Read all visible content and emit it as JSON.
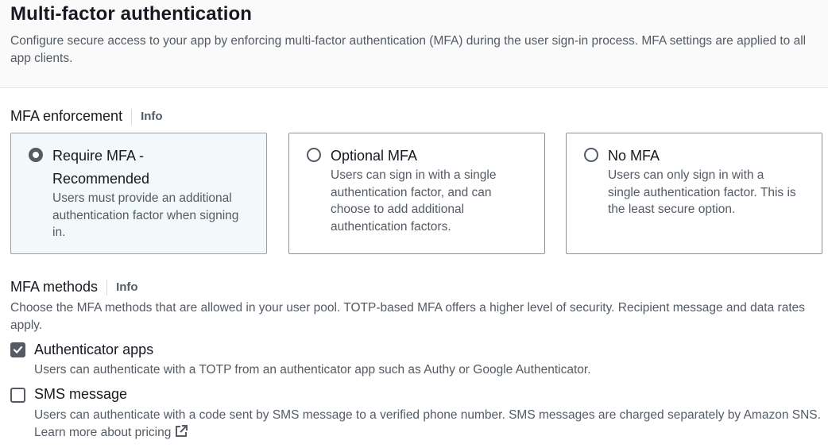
{
  "header": {
    "title": "Multi-factor authentication",
    "subtitle": "Configure secure access to your app by enforcing multi-factor authentication (MFA) during the user sign-in process. MFA settings are applied to all app clients."
  },
  "mfa_enforcement": {
    "label": "MFA enforcement",
    "info": "Info",
    "selected": "require",
    "options": [
      {
        "id": "require",
        "title_line1": "Require MFA -",
        "title_line2": "Recommended",
        "description": "Users must provide an additional authentication factor when signing in."
      },
      {
        "id": "optional",
        "title": "Optional MFA",
        "description": "Users can sign in with a single authentication factor, and can choose to add additional authentication factors."
      },
      {
        "id": "none",
        "title": "No MFA",
        "description": "Users can only sign in with a single authentication factor. This is the least secure option."
      }
    ]
  },
  "mfa_methods": {
    "label": "MFA methods",
    "info": "Info",
    "description": "Choose the MFA methods that are allowed in your user pool. TOTP-based MFA offers a higher level of security. Recipient message and data rates apply.",
    "options": [
      {
        "id": "authenticator_apps",
        "label": "Authenticator apps",
        "checked": true,
        "description": "Users can authenticate with a TOTP from an authenticator app such as Authy or Google Authenticator."
      },
      {
        "id": "sms",
        "label": "SMS message",
        "checked": false,
        "description": "Users can authenticate with a code sent by SMS message to a verified phone number. SMS messages are charged separately by Amazon SNS.",
        "link_text": "Learn more about pricing",
        "link_icon": "external-link-icon"
      }
    ]
  },
  "colors": {
    "selected_card_bg": "#f1f9fb",
    "text_primary": "#16191f",
    "text_secondary": "#545b64",
    "control": "#545b64"
  }
}
